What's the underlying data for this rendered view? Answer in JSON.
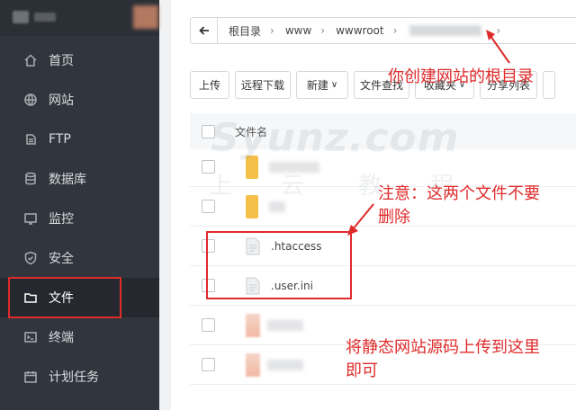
{
  "sidebar": {
    "items": [
      {
        "label": "首页",
        "icon": "home-icon"
      },
      {
        "label": "网站",
        "icon": "globe-icon"
      },
      {
        "label": "FTP",
        "icon": "ftp-icon"
      },
      {
        "label": "数据库",
        "icon": "database-icon"
      },
      {
        "label": "监控",
        "icon": "monitor-icon"
      },
      {
        "label": "安全",
        "icon": "shield-icon"
      },
      {
        "label": "文件",
        "icon": "folder-icon",
        "active": true
      },
      {
        "label": "终端",
        "icon": "terminal-icon"
      },
      {
        "label": "计划任务",
        "icon": "calendar-icon"
      }
    ]
  },
  "path": {
    "segments": [
      "根目录",
      "www",
      "wwwroot"
    ]
  },
  "toolbar": {
    "buttons": [
      "上传",
      "远程下载",
      "新建",
      "文件查找",
      "收藏夹",
      "分享列表"
    ]
  },
  "table": {
    "header": "文件名",
    "files": [
      ".htaccess",
      ".user.ini"
    ]
  },
  "watermark": {
    "brand": "Syunz.com",
    "chars": [
      "上",
      "云",
      "教",
      "程"
    ]
  },
  "annotations": {
    "root_dir": "你创建网站的根目录",
    "warning_line1": "注意：这两个文件不要",
    "warning_line2": "删除",
    "upload_line1": "将静态网站源码上传到这里",
    "upload_line2": "即可"
  },
  "colors": {
    "sidebar_bg": "#31363e",
    "annotation_red": "#e02b2b",
    "folder_yellow": "#f5c04a"
  }
}
